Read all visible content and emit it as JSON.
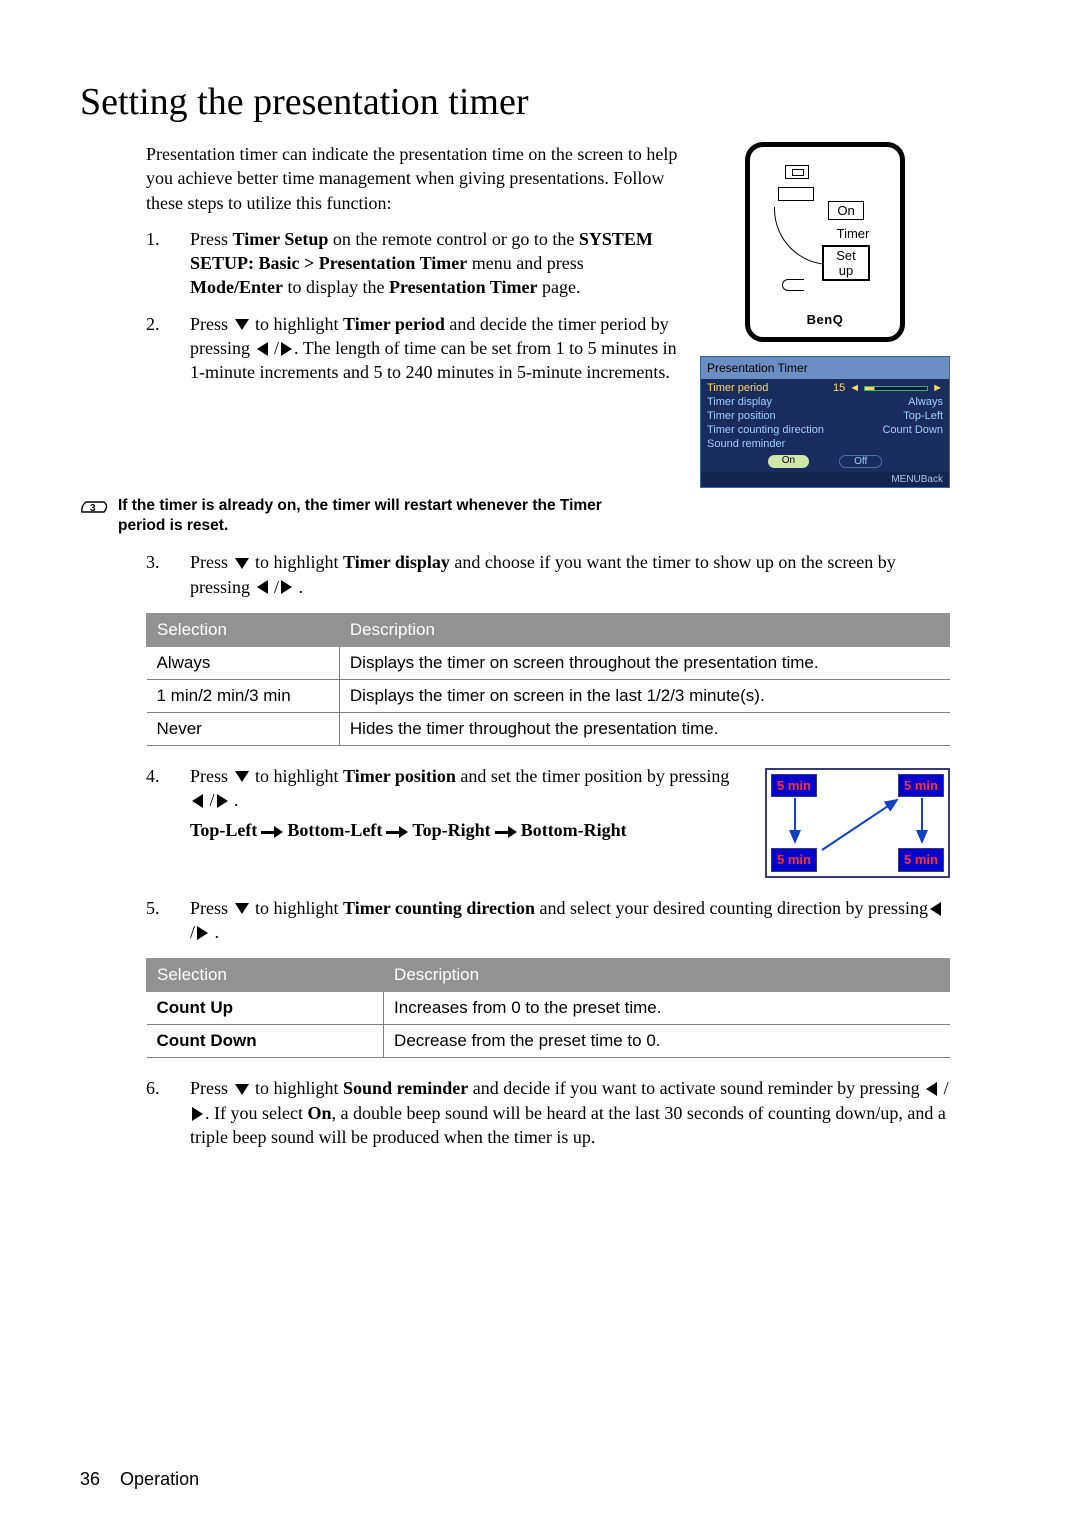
{
  "title": "Setting the presentation timer",
  "intro": "Presentation timer can indicate the presentation time on the screen to help you achieve better time management when giving presentations. Follow these steps to utilize this function:",
  "steps": {
    "s1_a": "Press ",
    "s1_b": "Timer Setup",
    "s1_c": " on the remote control or go to the ",
    "s1_d": "SYSTEM SETUP: Basic > Presentation Timer",
    "s1_e": " menu and press ",
    "s1_f": "Mode/Enter",
    "s1_g": " to display the ",
    "s1_h": "Presentation Timer",
    "s1_i": " page.",
    "s2_a": "Press ",
    "s2_b": " to highlight ",
    "s2_c": "Timer period",
    "s2_d": " and decide the timer period by pressing ",
    "s2_e": ". The length of time can be set from 1 to 5 minutes in 1-minute increments and 5 to 240 minutes in 5-minute increments.",
    "s3_a": "Press ",
    "s3_b": " to highlight ",
    "s3_c": "Timer display",
    "s3_d": " and choose if you want the timer to show up on the screen by pressing ",
    "s4_a": "Press ",
    "s4_b": " to highlight ",
    "s4_c": "Timer position",
    "s4_d": " and set the timer position by pressing ",
    "s4_seq_a": "Top-Left",
    "s4_seq_b": "Bottom-Left",
    "s4_seq_c": "Top-Right",
    "s4_seq_d": "Bottom-Right",
    "s5_a": "Press ",
    "s5_b": " to highlight ",
    "s5_c": "Timer counting direction",
    "s5_d": " and select your desired counting direction by pressing",
    "s6_a": "Press ",
    "s6_b": " to highlight ",
    "s6_c": "Sound reminder",
    "s6_d": " and decide if you want to activate sound reminder by pressing ",
    "s6_e": ". If you select ",
    "s6_f": "On",
    "s6_g": ", a double beep sound will be heard at the last 30 seconds of counting down/up, and a triple beep sound will be produced when the timer is up."
  },
  "note": "If the timer is already on, the timer will restart whenever the Timer period is reset.",
  "remote": {
    "on": "On",
    "timer": "Timer",
    "setup": "Set up",
    "logo": "BenQ"
  },
  "osd": {
    "title": "Presentation Timer",
    "rows": [
      {
        "label": "Timer period",
        "value": "15"
      },
      {
        "label": "Timer display",
        "value": "Always"
      },
      {
        "label": "Timer position",
        "value": "Top-Left"
      },
      {
        "label": "Timer counting direction",
        "value": "Count Down"
      },
      {
        "label": "Sound reminder",
        "value": ""
      }
    ],
    "btn_on": "On",
    "btn_off": "Off",
    "footer": "MENUBack"
  },
  "table1": {
    "h1": "Selection",
    "h2": "Description",
    "rows": [
      {
        "a": "Always",
        "b": "Displays the timer on screen throughout the presentation time."
      },
      {
        "a": "1 min/2 min/3 min",
        "b": "Displays the timer on screen in the last 1/2/3 minute(s)."
      },
      {
        "a": "Never",
        "b": "Hides the timer throughout the presentation time."
      }
    ]
  },
  "posdiag": {
    "label": "5 min"
  },
  "table2": {
    "h1": "Selection",
    "h2": "Description",
    "rows": [
      {
        "a": "Count Up",
        "b": "Increases from 0 to the preset time."
      },
      {
        "a": "Count Down",
        "b": "Decrease from the preset time to 0."
      }
    ]
  },
  "footer": {
    "page": "36",
    "section": "Operation"
  }
}
